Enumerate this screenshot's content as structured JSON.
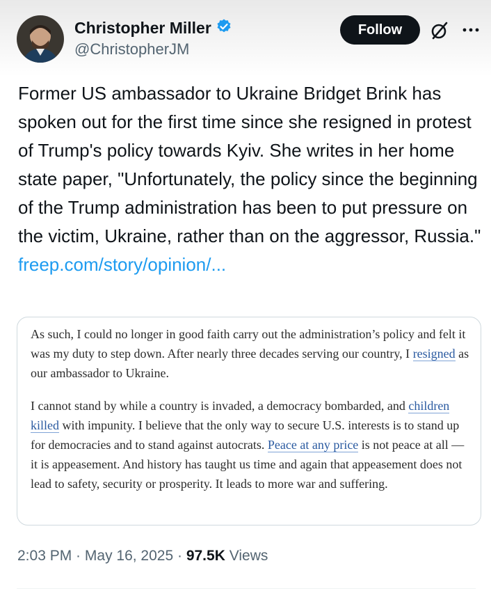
{
  "author": {
    "name": "Christopher Miller",
    "handle": "@ChristopherJM",
    "verified_color": "#1d9bf0"
  },
  "actions": {
    "follow_label": "Follow",
    "grok_icon": "grok-icon",
    "more_icon": "more-icon"
  },
  "tweet": {
    "text": "Former US ambassador to Ukraine Bridget Brink has spoken out for the first time since she resigned in protest of Trump's policy towards Kyiv. She writes in her home state paper, \"Unfortunately, the policy since the beginning of the Trump administration has been to put pressure on the victim, Ukraine, rather than on the aggressor, Russia.\"",
    "link_text": "freep.com/story/opinion/..."
  },
  "quote": {
    "p1_a": "As such, I could no longer in good faith carry out the administration’s policy and felt it was my duty to step down. After nearly three decades serving our country, I ",
    "p1_link": "resigned",
    "p1_b": " as our ambassador to Ukraine.",
    "p2_a": "I cannot stand by while a country is invaded, a democracy bombarded, and ",
    "p2_link1": "children killed",
    "p2_b": " with impunity. I believe that the only way to secure U.S. interests is to stand up for democracies and to stand against autocrats. ",
    "p2_link2": "Peace at any price",
    "p2_c": " is not peace at all — it is appeasement. And history has taught us time and again that appeasement does not lead to safety, security or prosperity. It leads to more war and suffering."
  },
  "meta": {
    "time": "2:03 PM",
    "separator": " · ",
    "date": "May 16, 2025",
    "views_count": "97.5K",
    "views_label": "Views"
  },
  "colors": {
    "link": "#1d9bf0",
    "text": "#0f1419",
    "secondary": "#536471",
    "button_bg": "#0f1419"
  }
}
